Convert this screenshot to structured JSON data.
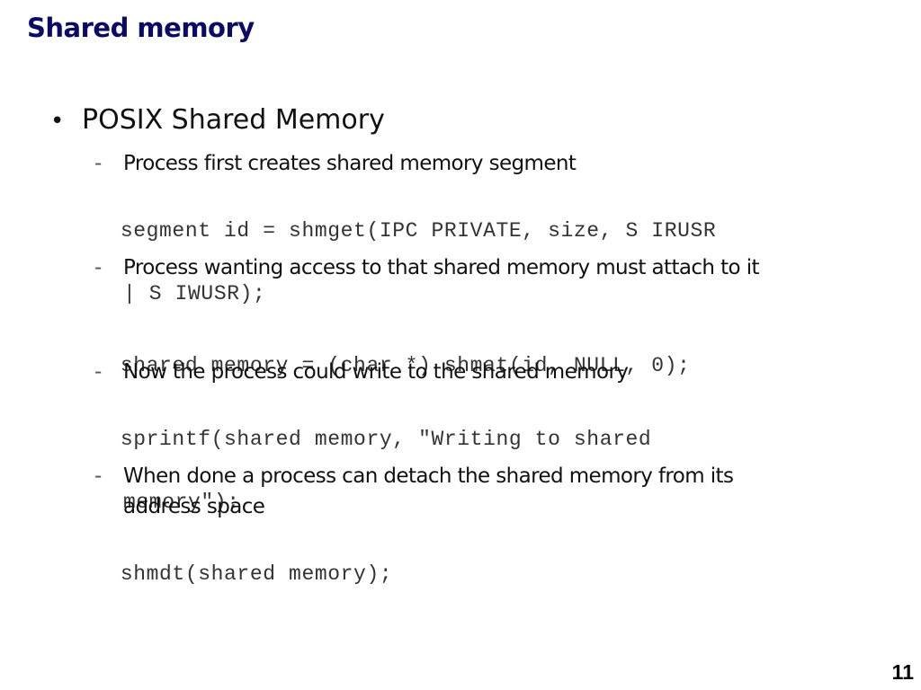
{
  "slide": {
    "title": "Shared memory",
    "page_number": "11",
    "bullet": {
      "marker": "•",
      "text": "POSIX Shared Memory"
    },
    "items": [
      {
        "type": "sub",
        "marker": "-",
        "text": "Process first creates shared memory segment"
      },
      {
        "type": "code",
        "line1": "segment id = shmget(IPC PRIVATE, size, S IRUSR",
        "line2": "| S IWUSR);"
      },
      {
        "type": "sub",
        "marker": "-",
        "text": "Process wanting access to that shared memory must attach to it"
      },
      {
        "type": "code",
        "line1": "shared memory = (char *) shmat(id, NULL, 0);"
      },
      {
        "type": "sub",
        "marker": "-",
        "text": "Now the process could write to the shared memory"
      },
      {
        "type": "code",
        "line1": "sprintf(shared memory, \"Writing to shared",
        "line2": "memory\");"
      },
      {
        "type": "sub",
        "marker": "-",
        "text": "When done a process can detach the shared memory from its address space"
      },
      {
        "type": "code",
        "line1": "shmdt(shared memory);"
      }
    ]
  }
}
